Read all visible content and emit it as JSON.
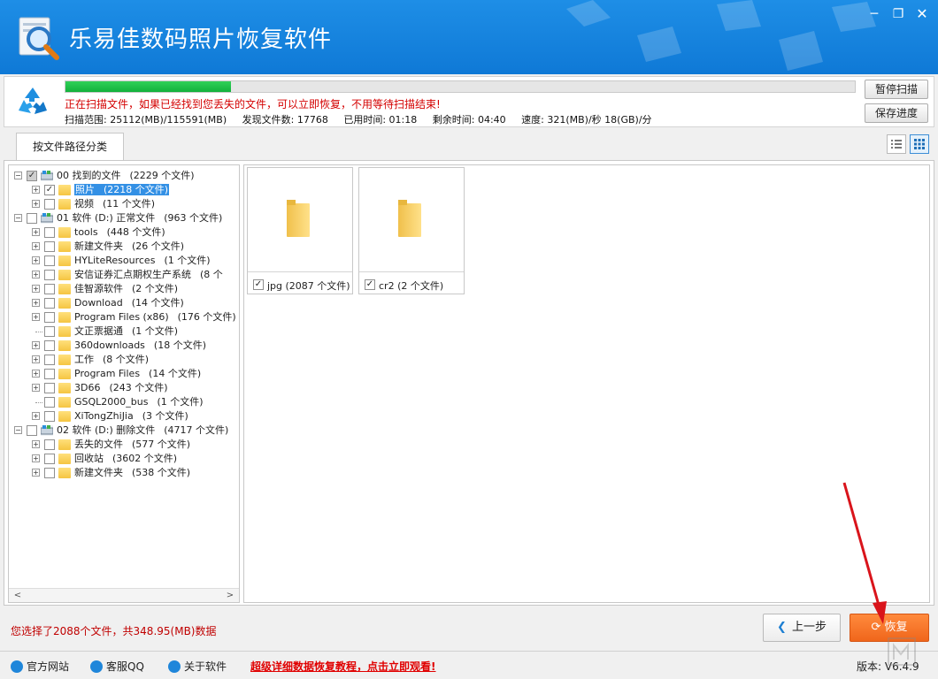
{
  "window": {
    "title": "乐易佳数码照片恢复软件",
    "min": "─",
    "max": "❐",
    "close": "✕"
  },
  "scan": {
    "progress": 0.21,
    "message": "正在扫描文件，如果已经找到您丢失的文件，可以立即恢复，不用等待扫描结束!",
    "range": "扫描范围: 25112(MB)/115591(MB)",
    "found": "发现文件数: 17768",
    "elapsed": "已用时间: 01:18",
    "remaining": "剩余时间: 04:40",
    "speed": "速度: 321(MB)/秒  18(GB)/分",
    "pause_label": "暂停扫描",
    "save_label": "保存进度"
  },
  "tabs": [
    {
      "label": "按文件路径分类"
    }
  ],
  "tree": [
    {
      "level": 0,
      "expander": "−",
      "check": "partial",
      "icon": "drive",
      "name": "00 找到的文件",
      "count": "(2229 个文件)"
    },
    {
      "level": 1,
      "expander": "+",
      "check": "checked",
      "icon": "folder",
      "name": "照片",
      "count": "(2218 个文件)",
      "selected": true
    },
    {
      "level": 1,
      "expander": "+",
      "check": "none",
      "icon": "folder",
      "name": "视频",
      "count": "(11 个文件)"
    },
    {
      "level": 0,
      "expander": "−",
      "check": "none",
      "icon": "drive",
      "name": "01 软件 (D:) 正常文件",
      "count": "(963 个文件)"
    },
    {
      "level": 1,
      "expander": "+",
      "check": "none",
      "icon": "folder",
      "name": "tools",
      "count": "(448 个文件)"
    },
    {
      "level": 1,
      "expander": "+",
      "check": "none",
      "icon": "folder",
      "name": "新建文件夹",
      "count": "(26 个文件)"
    },
    {
      "level": 1,
      "expander": "+",
      "check": "none",
      "icon": "folder",
      "name": "HYLiteResources",
      "count": "(1 个文件)"
    },
    {
      "level": 1,
      "expander": "+",
      "check": "none",
      "icon": "folder",
      "name": "安信证券汇点期权生产系统",
      "count": "(8 个"
    },
    {
      "level": 1,
      "expander": "+",
      "check": "none",
      "icon": "folder",
      "name": "佳智源软件",
      "count": "(2 个文件)"
    },
    {
      "level": 1,
      "expander": "+",
      "check": "none",
      "icon": "folder",
      "name": "Download",
      "count": "(14 个文件)"
    },
    {
      "level": 1,
      "expander": "+",
      "check": "none",
      "icon": "folder",
      "name": "Program Files (x86)",
      "count": "(176 个文件)"
    },
    {
      "level": 1,
      "expander": "",
      "check": "none",
      "icon": "folder",
      "name": "文正票据通",
      "count": "(1 个文件)"
    },
    {
      "level": 1,
      "expander": "+",
      "check": "none",
      "icon": "folder",
      "name": "360downloads",
      "count": "(18 个文件)"
    },
    {
      "level": 1,
      "expander": "+",
      "check": "none",
      "icon": "folder",
      "name": "工作",
      "count": "(8 个文件)"
    },
    {
      "level": 1,
      "expander": "+",
      "check": "none",
      "icon": "folder",
      "name": "Program Files",
      "count": "(14 个文件)"
    },
    {
      "level": 1,
      "expander": "+",
      "check": "none",
      "icon": "folder",
      "name": "3D66",
      "count": "(243 个文件)"
    },
    {
      "level": 1,
      "expander": "",
      "check": "none",
      "icon": "folder",
      "name": "GSQL2000_bus",
      "count": "(1 个文件)"
    },
    {
      "level": 1,
      "expander": "+",
      "check": "none",
      "icon": "folder",
      "name": "XiTongZhiJia",
      "count": "(3 个文件)"
    },
    {
      "level": 0,
      "expander": "−",
      "check": "none",
      "icon": "drive",
      "name": "02 软件 (D:) 删除文件",
      "count": "(4717 个文件)"
    },
    {
      "level": 1,
      "expander": "+",
      "check": "none",
      "icon": "folder",
      "name": "丢失的文件",
      "count": "(577 个文件)"
    },
    {
      "level": 1,
      "expander": "+",
      "check": "none",
      "icon": "folder",
      "name": "回收站",
      "count": "(3602 个文件)"
    },
    {
      "level": 1,
      "expander": "+",
      "check": "none",
      "icon": "folder",
      "name": "新建文件夹",
      "count": "(538 个文件)"
    }
  ],
  "tiles": [
    {
      "label": "jpg  (2087 个文件)",
      "checked": "✓"
    },
    {
      "label": "cr2  (2 个文件)",
      "checked": "✓"
    }
  ],
  "scroll": {
    "left": "<",
    "right": ">"
  },
  "bottom": {
    "selection_info": "您选择了2088个文件，共348.95(MB)数据",
    "prev_label": "上一步",
    "recover_label": "恢复"
  },
  "footer": {
    "website": "官方网站",
    "qq": "客服QQ",
    "about": "关于软件",
    "tutorial": "超级详细数据恢复教程，点击立即观看!",
    "version": "版本: V6.4.9"
  },
  "colors": {
    "title_bg": "#1584e0",
    "accent_orange": "#f07325",
    "warning_red": "#d40000",
    "progress_green": "#22c04a"
  }
}
